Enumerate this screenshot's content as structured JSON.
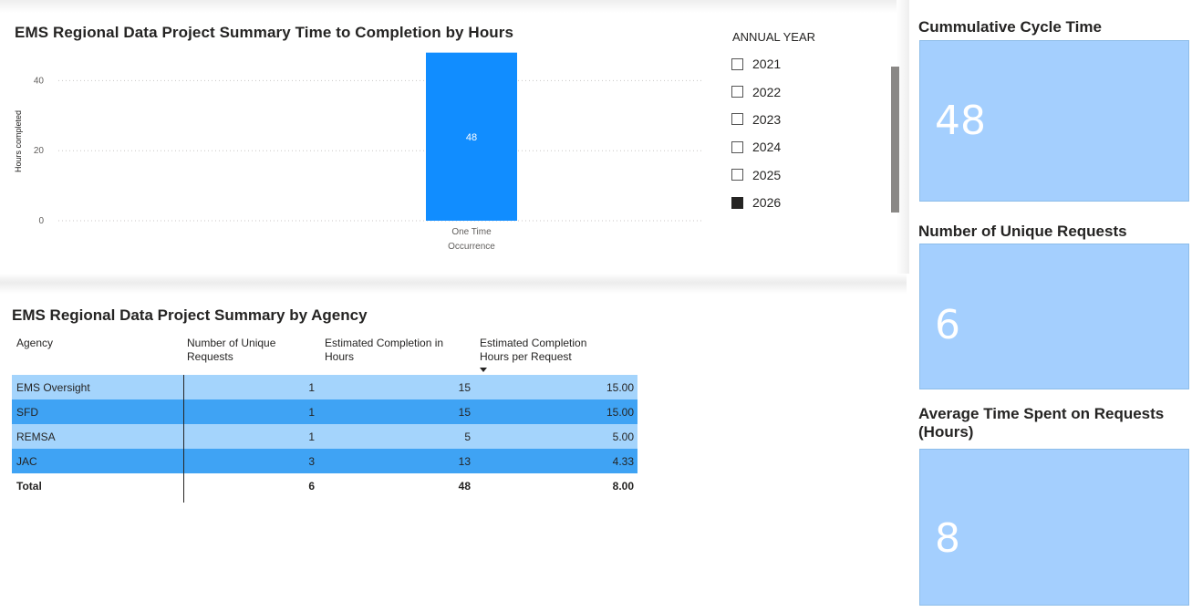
{
  "chart": {
    "title": "EMS Regional Data Project Summary Time to Completion by Hours",
    "y_axis_title": "Hours completed",
    "y_ticks": [
      "0",
      "20",
      "40"
    ],
    "category_line1": "One Time",
    "category_line2": "Occurrence",
    "bar_label": "48",
    "bar_color": "#118dff"
  },
  "chart_data": {
    "type": "bar",
    "categories": [
      "One Time Occurrence"
    ],
    "values": [
      48
    ],
    "title": "EMS Regional Data Project Summary Time to Completion by Hours",
    "xlabel": "",
    "ylabel": "Hours completed",
    "ylim": [
      0,
      50
    ],
    "grid": true
  },
  "slicer": {
    "title": "ANNUAL YEAR",
    "items": [
      {
        "label": "2021",
        "checked": false
      },
      {
        "label": "2022",
        "checked": false
      },
      {
        "label": "2023",
        "checked": false
      },
      {
        "label": "2024",
        "checked": false
      },
      {
        "label": "2025",
        "checked": false
      },
      {
        "label": "2026",
        "checked": true
      }
    ]
  },
  "table": {
    "title": "EMS Regional Data Project Summary by Agency",
    "headers": {
      "agency": "Agency",
      "unique_1": "Number of Unique",
      "unique_2": "Requests",
      "est_1": "Estimated Completion in",
      "est_2": "Hours",
      "per_1": "Estimated Completion",
      "per_2": "Hours per Request"
    },
    "rows": [
      {
        "agency": "EMS Oversight",
        "unique": "1",
        "hours": "15",
        "per": "15.00"
      },
      {
        "agency": "SFD",
        "unique": "1",
        "hours": "15",
        "per": "15.00"
      },
      {
        "agency": "REMSA",
        "unique": "1",
        "hours": "5",
        "per": "5.00"
      },
      {
        "agency": "JAC",
        "unique": "3",
        "hours": "13",
        "per": "4.33"
      }
    ],
    "total": {
      "label": "Total",
      "unique": "6",
      "hours": "48",
      "per": "8.00"
    },
    "row_colors": [
      "#a4d4fc",
      "#3fa3f4"
    ]
  },
  "kpis": [
    {
      "title": "Cummulative Cycle Time",
      "value": "48"
    },
    {
      "title": "Number of Unique Requests",
      "value": "6"
    },
    {
      "title": "Average Time Spent on Requests (Hours)",
      "value": "8"
    }
  ]
}
